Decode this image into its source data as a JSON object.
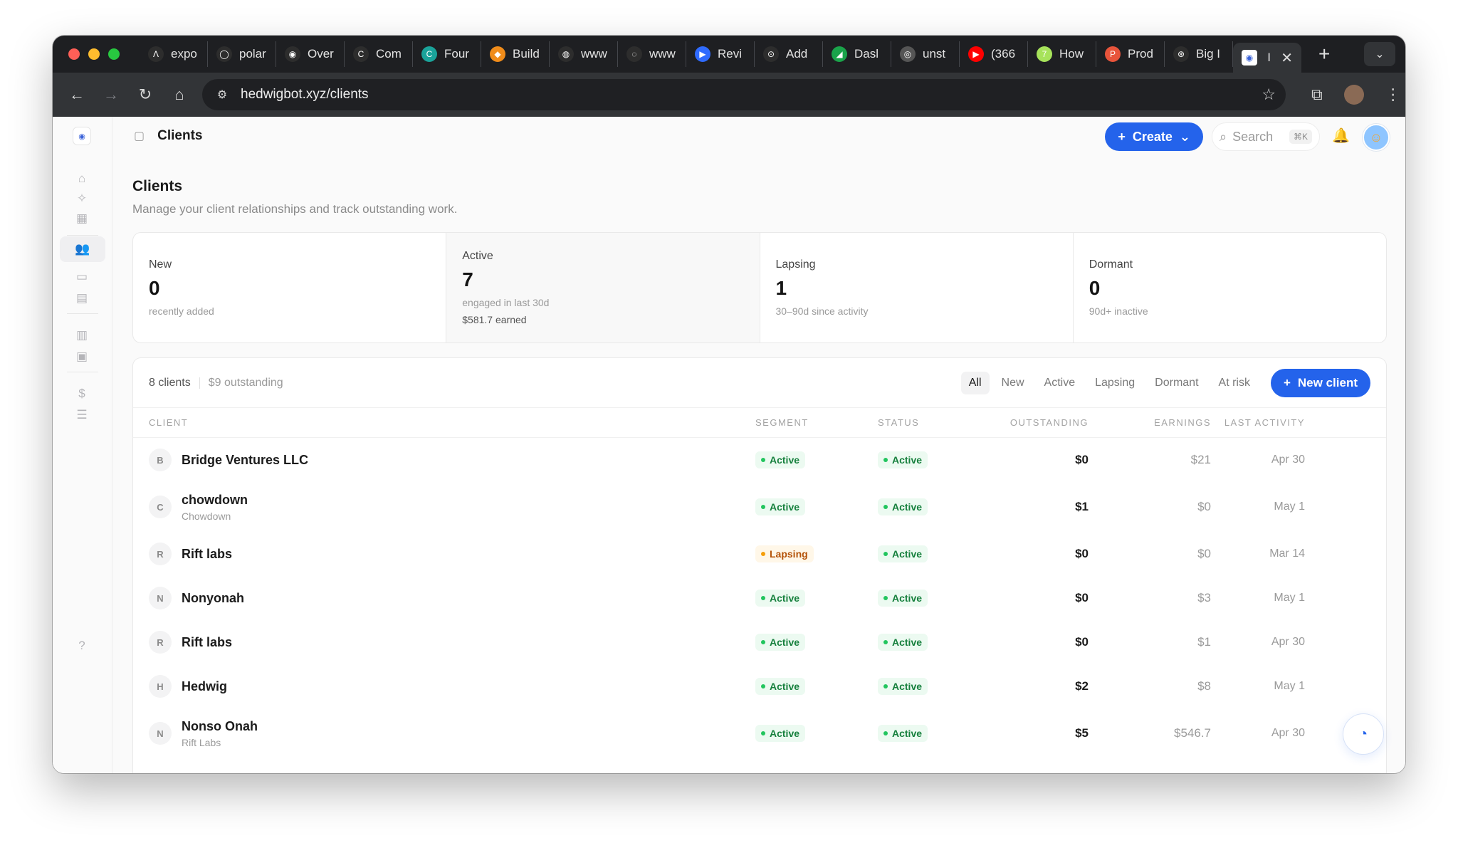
{
  "browser": {
    "tabs": [
      {
        "label": "expo",
        "color": "#2d2d2d",
        "glyph": "Λ"
      },
      {
        "label": "polar",
        "color": "#2d2d2d",
        "glyph": "◯"
      },
      {
        "label": "Over",
        "color": "#2d2d2d",
        "glyph": "◉"
      },
      {
        "label": "Com",
        "color": "#2d2d2d",
        "glyph": "C"
      },
      {
        "label": "Four",
        "color": "#1aa39a",
        "glyph": "C"
      },
      {
        "label": "Build",
        "color": "#f08c1a",
        "glyph": "◆"
      },
      {
        "label": "www",
        "color": "#2d2d2d",
        "glyph": "◍"
      },
      {
        "label": "www",
        "color": "#2d2d2d",
        "glyph": "◌"
      },
      {
        "label": "Revi",
        "color": "#2f6bff",
        "glyph": "▶"
      },
      {
        "label": "Add",
        "color": "#2d2d2d",
        "glyph": "⊙"
      },
      {
        "label": "Dasl",
        "color": "#1aa34a",
        "glyph": "◢"
      },
      {
        "label": "unst",
        "color": "#555555",
        "glyph": "◎"
      },
      {
        "label": "(366",
        "color": "#ff0000",
        "glyph": "▶"
      },
      {
        "label": "How",
        "color": "#a7e35b",
        "glyph": "7"
      },
      {
        "label": "Prod",
        "color": "#e8543b",
        "glyph": "P"
      },
      {
        "label": "Big I",
        "color": "#2d2d2d",
        "glyph": "⊛"
      }
    ],
    "active_tab": {
      "label": "I",
      "close": "✕"
    },
    "new_tab": "+",
    "tab_menu": "⌄",
    "url": "hedwigbot.xyz/clients"
  },
  "topbar": {
    "breadcrumb": "Clients",
    "create_label": "Create",
    "search_placeholder": "Search",
    "search_shortcut": "⌘K"
  },
  "page": {
    "title": "Clients",
    "subtitle": "Manage your client relationships and track outstanding work."
  },
  "stats": [
    {
      "label": "New",
      "value": "0",
      "desc": "recently added",
      "extra": ""
    },
    {
      "label": "Active",
      "value": "7",
      "desc": "engaged in last 30d",
      "extra": "$581.7 earned"
    },
    {
      "label": "Lapsing",
      "value": "1",
      "desc": "30–90d since activity",
      "extra": ""
    },
    {
      "label": "Dormant",
      "value": "0",
      "desc": "90d+ inactive",
      "extra": ""
    }
  ],
  "table": {
    "count": "8 clients",
    "outstanding": "$9 outstanding",
    "filters": [
      "All",
      "New",
      "Active",
      "Lapsing",
      "Dormant",
      "At risk"
    ],
    "active_filter": "All",
    "new_client_label": "New client",
    "columns": {
      "client": "CLIENT",
      "segment": "SEGMENT",
      "status": "STATUS",
      "outstanding": "OUTSTANDING",
      "earnings": "EARNINGS",
      "last_activity": "LAST ACTIVITY"
    },
    "rows": [
      {
        "initial": "B",
        "name": "Bridge Ventures LLC",
        "sub": "",
        "segment": "Active",
        "segment_tone": "green",
        "status": "Active",
        "outstanding": "$0",
        "earnings": "$21",
        "last": "Apr 30"
      },
      {
        "initial": "C",
        "name": "chowdown",
        "sub": "Chowdown",
        "segment": "Active",
        "segment_tone": "green",
        "status": "Active",
        "outstanding": "$1",
        "earnings": "$0",
        "last": "May 1"
      },
      {
        "initial": "R",
        "name": "Rift labs",
        "sub": "",
        "segment": "Lapsing",
        "segment_tone": "amber",
        "status": "Active",
        "outstanding": "$0",
        "earnings": "$0",
        "last": "Mar 14"
      },
      {
        "initial": "N",
        "name": "Nonyonah",
        "sub": "",
        "segment": "Active",
        "segment_tone": "green",
        "status": "Active",
        "outstanding": "$0",
        "earnings": "$3",
        "last": "May 1"
      },
      {
        "initial": "R",
        "name": "Rift labs",
        "sub": "",
        "segment": "Active",
        "segment_tone": "green",
        "status": "Active",
        "outstanding": "$0",
        "earnings": "$1",
        "last": "Apr 30"
      },
      {
        "initial": "H",
        "name": "Hedwig",
        "sub": "",
        "segment": "Active",
        "segment_tone": "green",
        "status": "Active",
        "outstanding": "$2",
        "earnings": "$8",
        "last": "May 1"
      },
      {
        "initial": "N",
        "name": "Nonso Onah",
        "sub": "Rift Labs",
        "segment": "Active",
        "segment_tone": "green",
        "status": "Active",
        "outstanding": "$5",
        "earnings": "$546.7",
        "last": "Apr 30"
      }
    ]
  },
  "colors": {
    "accent": "#2463eb",
    "status_green": "#16803d",
    "status_amber": "#b45309"
  },
  "sidebar_icons": [
    "home-icon",
    "sparkle-icon",
    "calendar-icon",
    "users-icon",
    "folder-icon",
    "card-icon",
    "chart-icon",
    "clipboard-icon",
    "dollar-icon",
    "sliders-icon",
    "help-icon"
  ]
}
